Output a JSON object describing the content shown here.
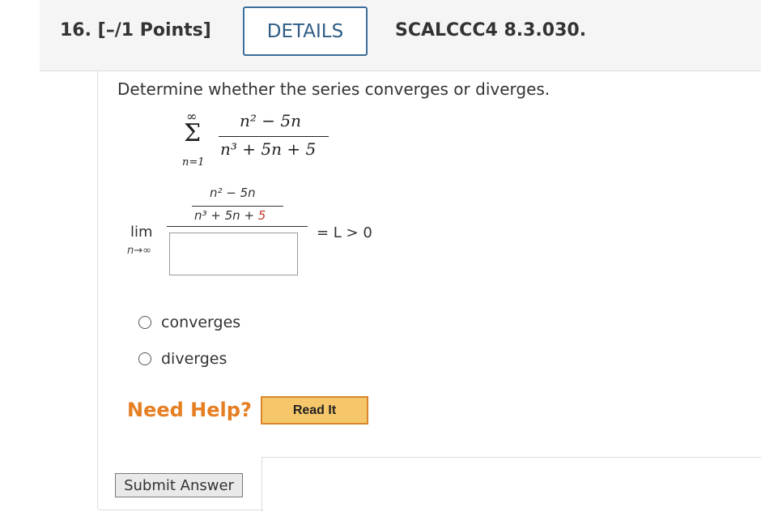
{
  "header": {
    "question_number": "16.",
    "points": "[–/1 Points]",
    "details_label": "DETAILS",
    "problem_code": "SCALCCC4 8.3.030."
  },
  "question": {
    "prompt": "Determine whether the series converges or diverges.",
    "series": {
      "upper_limit": "∞",
      "sigma": "Σ",
      "lower_limit": "n=1",
      "numerator": "n² − 5n",
      "denominator": "n³ + 5n + 5"
    },
    "limit": {
      "lim": "lim",
      "sub": "n→∞",
      "inner_numerator": "n² − 5n",
      "inner_denominator_a": "n³ + 5n + ",
      "inner_denominator_b": "5",
      "equals_condition": "= L > 0",
      "answer_value": ""
    },
    "options": [
      {
        "label": "converges",
        "selected": false
      },
      {
        "label": "diverges",
        "selected": false
      }
    ]
  },
  "help": {
    "need_help": "Need Help?",
    "read_it": "Read It"
  },
  "actions": {
    "submit": "Submit Answer"
  },
  "colors": {
    "details_border": "#3b6e9a",
    "need_help": "#e67e22",
    "read_it_bg": "#f6c66a",
    "accent_red": "#c0392b"
  }
}
